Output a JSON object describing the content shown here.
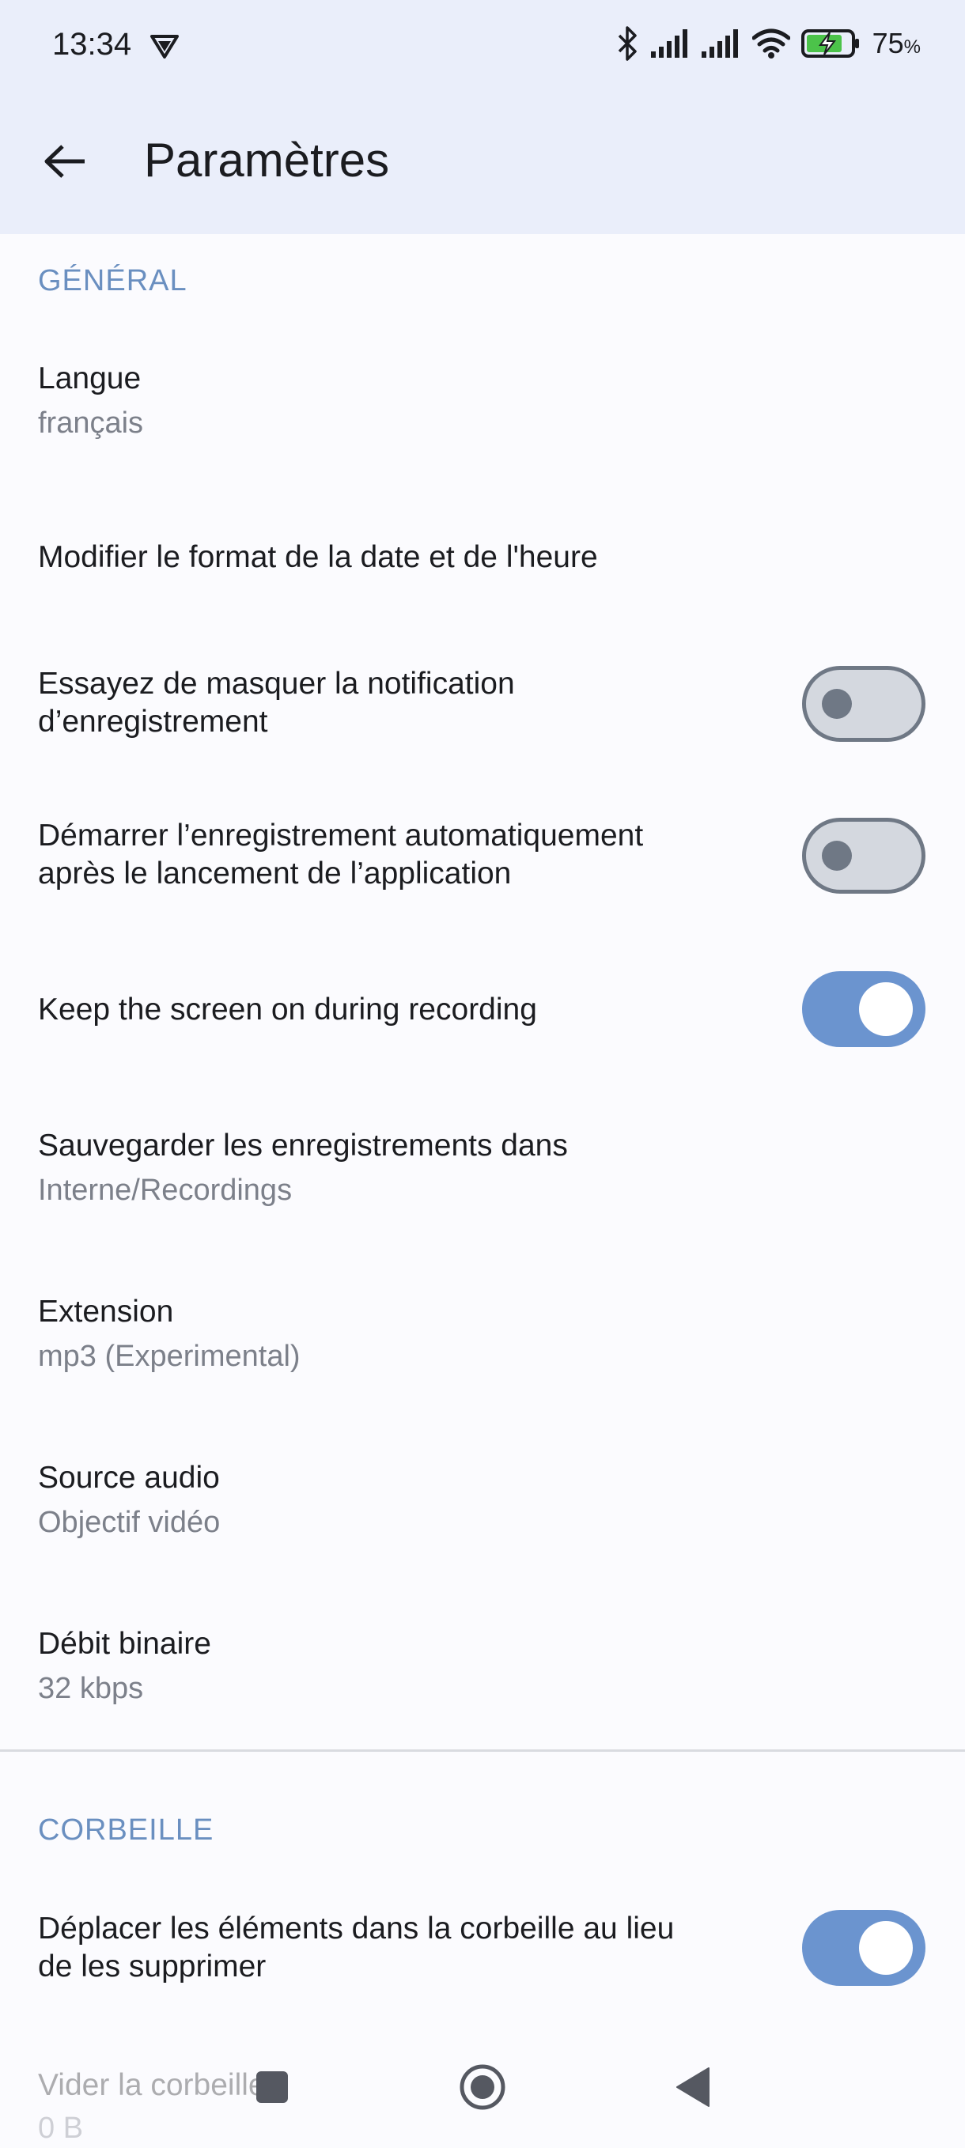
{
  "status": {
    "time": "13:34",
    "battery": "75",
    "battery_unit": "%"
  },
  "appbar": {
    "title": "Paramètres"
  },
  "sections": {
    "general": "GÉNÉRAL",
    "trash": "CORBEILLE"
  },
  "settings": {
    "language": {
      "title": "Langue",
      "summary": "français"
    },
    "date_format": {
      "title": "Modifier le format de la date et de l'heure"
    },
    "hide_notification": {
      "title_line1": "Essayez de masquer la notification",
      "title_line2": "d’enregistrement",
      "enabled": false
    },
    "auto_start": {
      "title_line1": "Démarrer l’enregistrement automatiquement",
      "title_line2": "après le lancement de l’application",
      "enabled": false
    },
    "keep_screen_on": {
      "title": "Keep the screen on during recording",
      "enabled": true
    },
    "save_location": {
      "title": "Sauvegarder les enregistrements dans",
      "summary": "Interne/Recordings"
    },
    "extension": {
      "title": "Extension",
      "summary": "mp3 (Experimental)"
    },
    "audio_source": {
      "title": "Source audio",
      "summary": "Objectif vidéo"
    },
    "bitrate": {
      "title": "Débit binaire",
      "summary": "32 kbps"
    },
    "move_to_trash": {
      "title_line1": "Déplacer les éléments dans la corbeille au lieu",
      "title_line2": "de les supprimer",
      "enabled": true
    },
    "empty_trash": {
      "title": "Vider la corbeille",
      "summary": "0 B"
    }
  },
  "colors": {
    "accent": "#6b94cf",
    "header_bg": "#eaeefa",
    "section_header": "#6a8fc0"
  },
  "icons": {
    "back": "arrow-left-icon",
    "vpn": "vpn-shield-icon",
    "bluetooth": "bluetooth-icon",
    "signal": "signal-icon",
    "wifi": "wifi-icon",
    "battery": "battery-charging-icon",
    "nav_recents": "square-icon",
    "nav_home": "circle-icon",
    "nav_back": "triangle-back-icon"
  }
}
